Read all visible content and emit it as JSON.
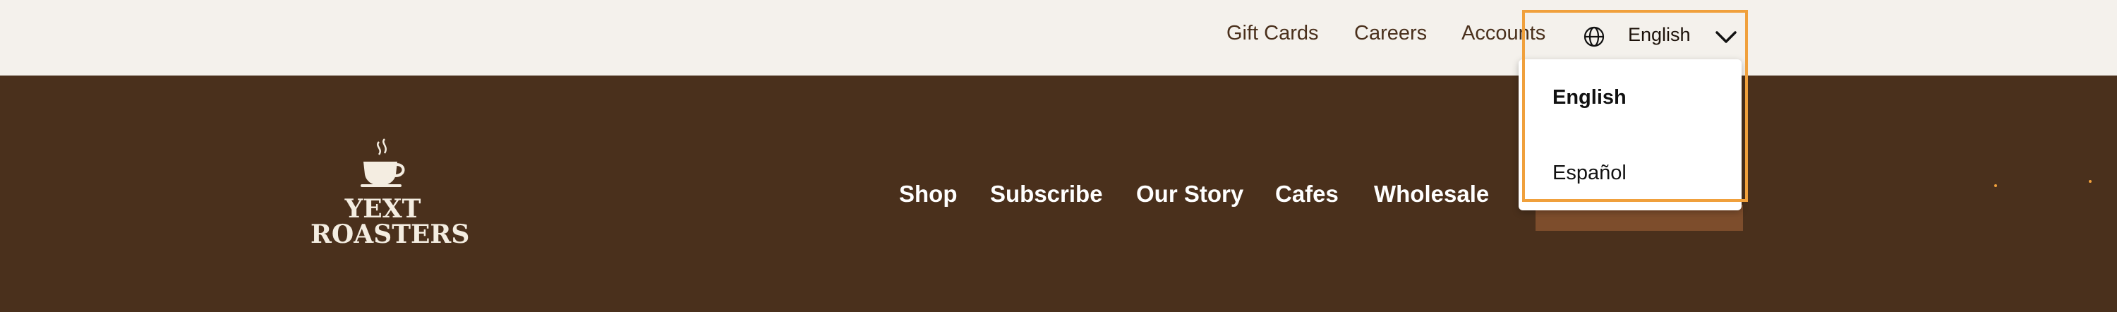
{
  "utility_nav": {
    "links": [
      "Gift Cards",
      "Careers",
      "Accounts"
    ],
    "language": {
      "current": "English",
      "options": [
        "English",
        "Español"
      ],
      "selected": "English"
    }
  },
  "brand": {
    "line1": "YEXT",
    "line2": "ROASTERS"
  },
  "main_nav": {
    "items": [
      "Shop",
      "Subscribe",
      "Our Story",
      "Cafes",
      "Wholesale"
    ]
  },
  "colors": {
    "brown": "#4a301c",
    "cream": "#f4f1ec",
    "accent": "#f0a03c"
  }
}
